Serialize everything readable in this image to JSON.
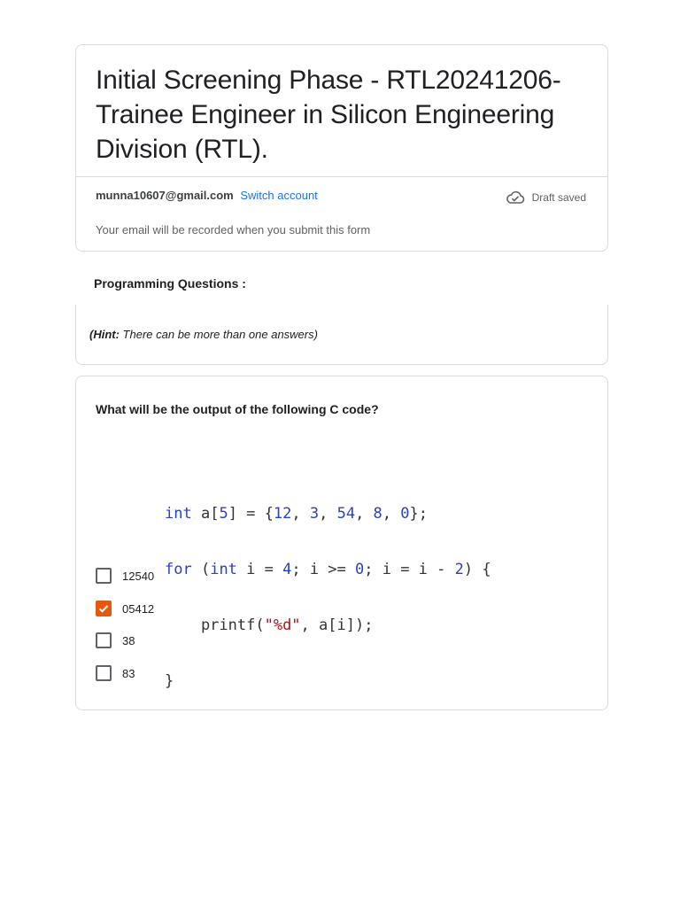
{
  "header": {
    "title": "Initial Screening Phase - RTL20241206-Trainee Engineer in Silicon Engineering Division (RTL).",
    "email": "munna10607@gmail.com",
    "switch_account": "Switch account",
    "draft_status": "Draft saved",
    "email_note": "Your email will be recorded when you submit this form"
  },
  "section": {
    "title": "Programming Questions :",
    "hint_label": "(Hint:",
    "hint_body": " There can be more than one answers)"
  },
  "question": {
    "title": "What will be the output of the following C code?",
    "code": {
      "line1": [
        "int",
        " a[",
        "5",
        "] = {",
        "12",
        ", ",
        "3",
        ", ",
        "54",
        ", ",
        "8",
        ", ",
        "0",
        "};"
      ],
      "line2": [
        "for",
        " (",
        "int",
        " i = ",
        "4",
        "; i >= ",
        "0",
        "; i = i - ",
        "2",
        ") {"
      ],
      "line3": [
        "    printf(",
        "\"%d\"",
        ", a[i]);"
      ],
      "line4": "}"
    },
    "options": [
      {
        "label": "12540",
        "checked": false
      },
      {
        "label": "05412",
        "checked": true
      },
      {
        "label": "38",
        "checked": false
      },
      {
        "label": "83",
        "checked": false
      }
    ]
  },
  "colors": {
    "accent": "#e8580c",
    "link": "#1a73e8"
  },
  "icons": {
    "draft": "cloud-check-icon",
    "checkmark": "checkmark-icon"
  }
}
